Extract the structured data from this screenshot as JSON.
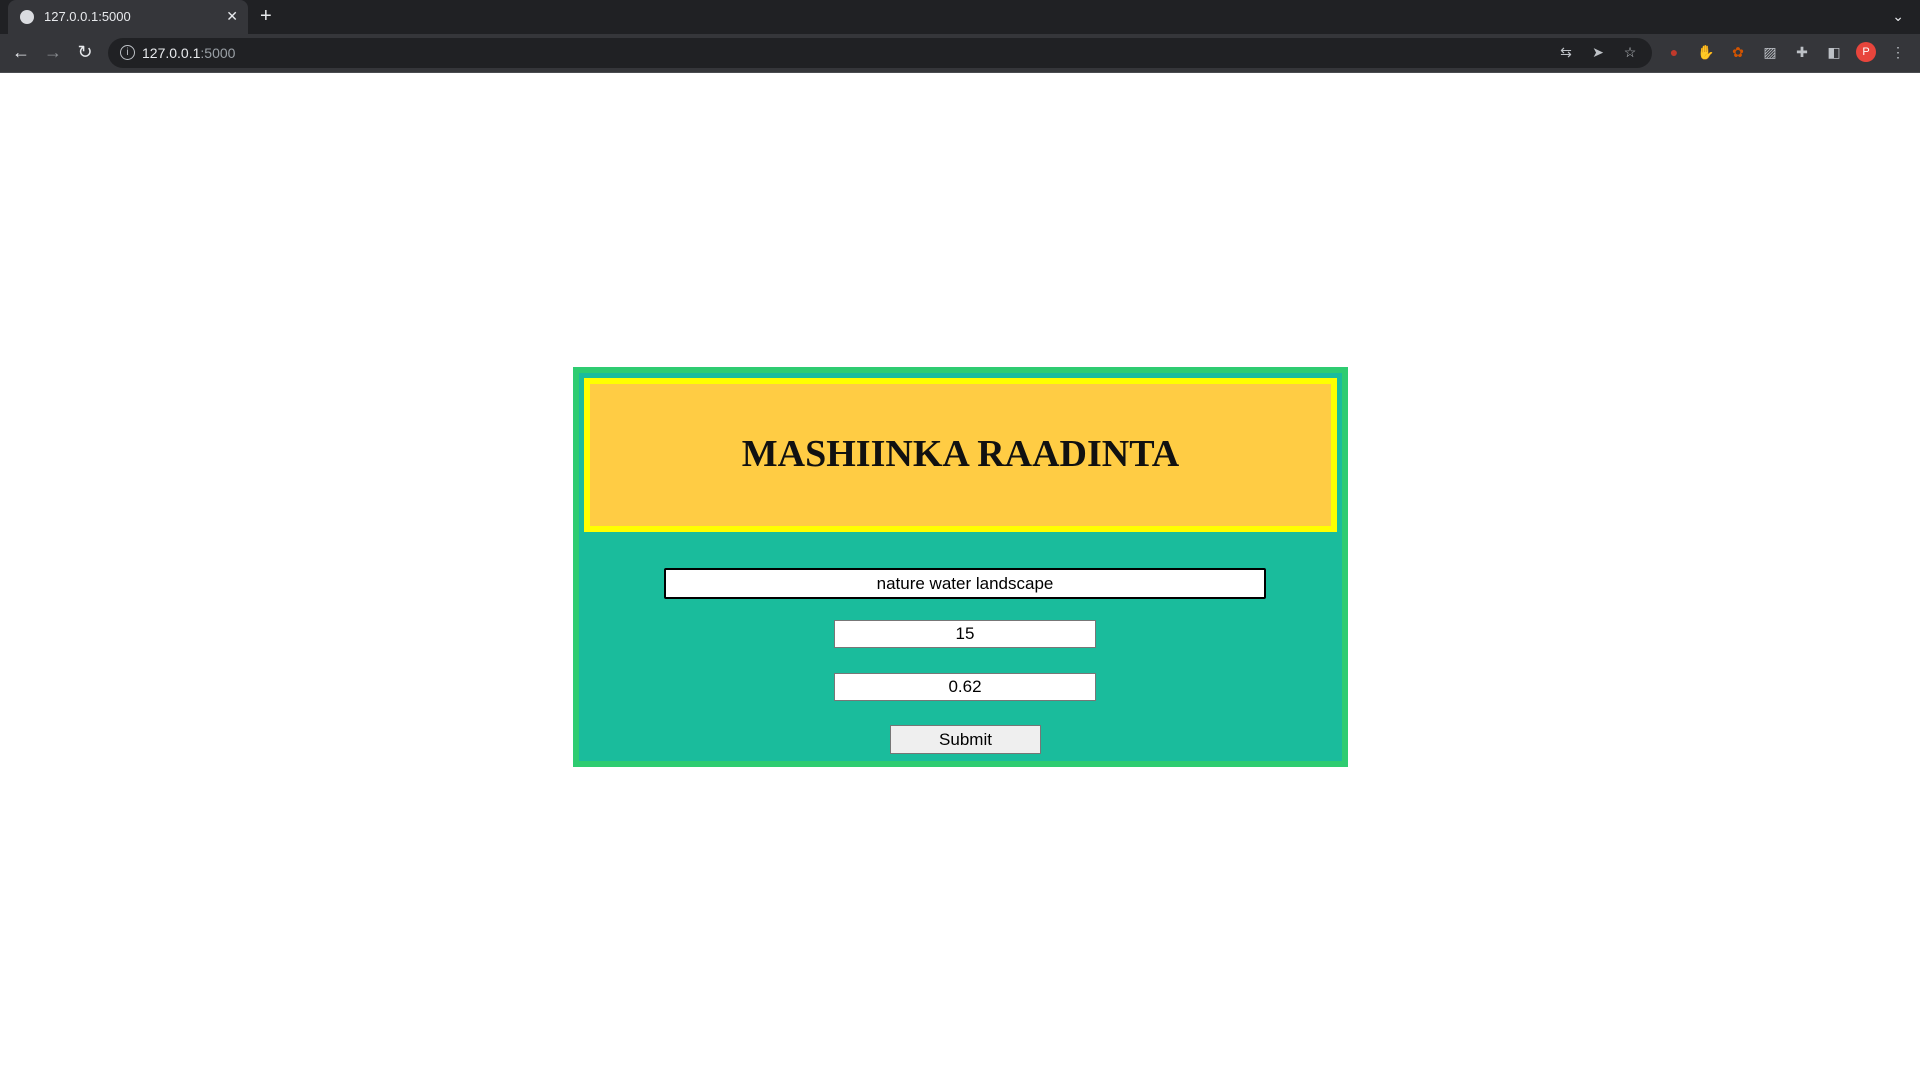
{
  "browser": {
    "tab_title": "127.0.0.1:5000",
    "close_glyph": "✕",
    "new_tab_glyph": "+",
    "url_host": "127.0.0.1",
    "url_port": ":5000",
    "profile_initial": "P"
  },
  "app": {
    "title": "MASHIINKA RAADINTA",
    "query_value": "nature water landscape",
    "number_value": "15",
    "ratio_value": "0.62",
    "submit_label": "Submit"
  }
}
